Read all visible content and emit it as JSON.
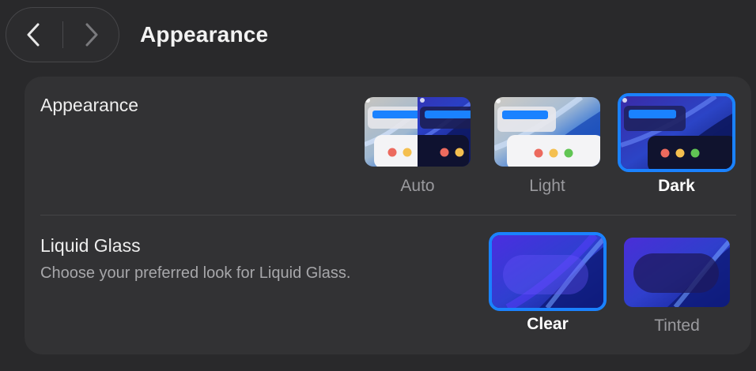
{
  "header": {
    "title": "Appearance"
  },
  "appearance": {
    "label": "Appearance",
    "options": [
      {
        "label": "Auto",
        "selected": false
      },
      {
        "label": "Light",
        "selected": false
      },
      {
        "label": "Dark",
        "selected": true
      }
    ]
  },
  "liquid_glass": {
    "label": "Liquid Glass",
    "description": "Choose your preferred look for Liquid Glass.",
    "options": [
      {
        "label": "Clear",
        "selected": true
      },
      {
        "label": "Tinted",
        "selected": false
      }
    ]
  },
  "colors": {
    "accent": "#1a82ff",
    "background": "#29292b",
    "panel": "#323234",
    "traffic_red": "#ec6a5e",
    "traffic_yellow": "#f4bf4f",
    "traffic_green": "#61c554"
  }
}
